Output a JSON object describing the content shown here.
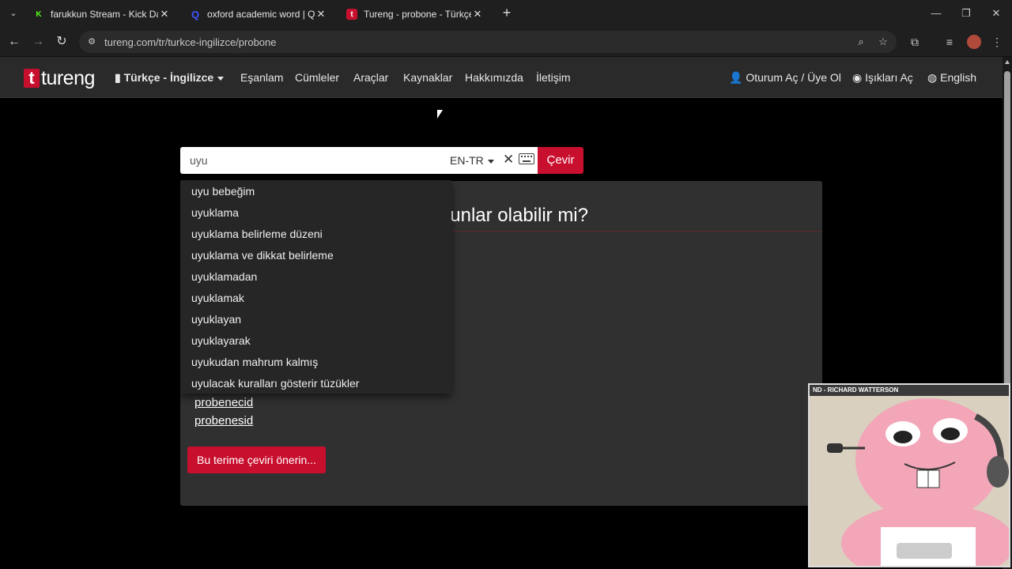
{
  "browser": {
    "tabs": [
      {
        "title": "farukkun Stream - Kick Dashbo",
        "favicon": "kick-icon",
        "color": "#53fc18"
      },
      {
        "title": "oxford academic word | Quizlet",
        "favicon": "quizlet-icon",
        "color": "#4255ff"
      },
      {
        "title": "Tureng - probone - Türkçe İngi",
        "favicon": "tureng-icon",
        "color": "#c8102e"
      }
    ],
    "url": "tureng.com/tr/turkce-ingilizce/probone"
  },
  "site": {
    "logo": "tureng",
    "logo_letter": "t",
    "nav": {
      "dictionary": "Türkçe - İngilizce",
      "links": [
        "Eşanlam",
        "Cümleler",
        "Araçlar",
        "Kaynaklar",
        "Hakkımızda",
        "İletişim"
      ],
      "login": "Oturum Aç / Üye Ol",
      "lights": "Işıkları Aç",
      "language": "English"
    },
    "accent": "#c8102e"
  },
  "search": {
    "value": "uyu",
    "lang": "EN-TR",
    "submit": "Çevir",
    "suggestions": [
      "uyu bebeğim",
      "uyuklama",
      "uyuklama belirleme düzeni",
      "uyuklama ve dikkat belirleme",
      "uyuklamadan",
      "uyuklamak",
      "uyuklayan",
      "uyuklayarak",
      "uyukudan mahrum kalmış",
      "uyulacak kuralları gösterir tüzükler"
    ]
  },
  "result_panel": {
    "heading_partial": "unlar olabilir mi?",
    "suggested_words": [
      "probenecid",
      "probenesid"
    ],
    "suggest_button": "Bu terime çeviri önerin..."
  },
  "webcam": {
    "label": "ND - RICHARD WATTERSON"
  }
}
